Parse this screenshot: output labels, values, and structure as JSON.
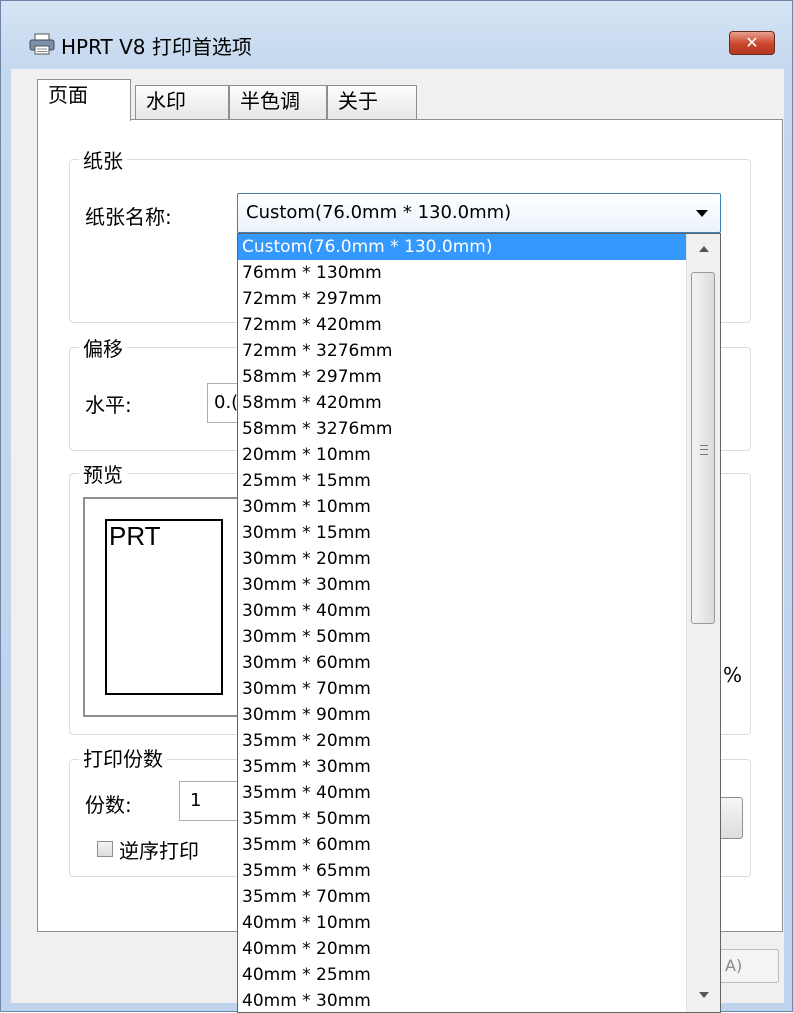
{
  "window": {
    "title": "HPRT V8 打印首选项",
    "close_glyph": "✕"
  },
  "tabs": [
    {
      "label": "页面",
      "active": true
    },
    {
      "label": "水印",
      "active": false
    },
    {
      "label": "半色调",
      "active": false
    },
    {
      "label": "关于",
      "active": false
    }
  ],
  "paper": {
    "group_title": "纸张",
    "name_label": "纸张名称:",
    "selected": "Custom(76.0mm * 130.0mm)",
    "options": [
      "Custom(76.0mm * 130.0mm)",
      "76mm * 130mm",
      "72mm * 297mm",
      "72mm * 420mm",
      "72mm * 3276mm",
      "58mm * 297mm",
      "58mm * 420mm",
      "58mm * 3276mm",
      "20mm * 10mm",
      "25mm * 15mm",
      "30mm * 10mm",
      "30mm * 15mm",
      "30mm * 20mm",
      "30mm * 30mm",
      "30mm * 40mm",
      "30mm * 50mm",
      "30mm * 60mm",
      "30mm * 70mm",
      "30mm * 90mm",
      "35mm * 20mm",
      "35mm * 30mm",
      "35mm * 40mm",
      "35mm * 50mm",
      "35mm * 60mm",
      "35mm * 65mm",
      "35mm * 70mm",
      "40mm * 10mm",
      "40mm * 20mm",
      "40mm * 25mm",
      "40mm * 30mm"
    ]
  },
  "offset": {
    "group_title": "偏移",
    "horizontal_label": "水平:",
    "horizontal_value": "0.("
  },
  "preview": {
    "group_title": "预览",
    "page_text": "PRT",
    "percent_fragment": "%"
  },
  "copies": {
    "group_title": "打印份数",
    "count_label": "份数:",
    "count_value": "1",
    "reverse_label": "逆序打印",
    "reverse_checked": false
  },
  "footer": {
    "apply_fragment": "A)"
  }
}
